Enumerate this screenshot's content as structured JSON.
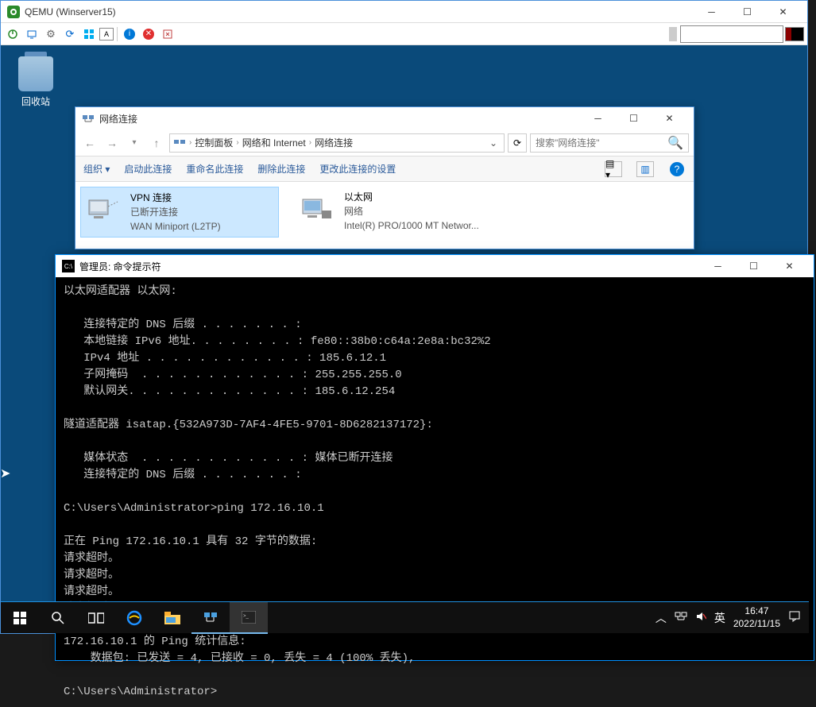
{
  "qemu": {
    "title": "QEMU (Winserver15)"
  },
  "desktop": {
    "recycle_bin": "回收站"
  },
  "explorer": {
    "title": "网络连接",
    "breadcrumb": [
      "控制面板",
      "网络和 Internet",
      "网络连接"
    ],
    "search_placeholder": "搜索\"网络连接\"",
    "cmdbar": {
      "organize": "组织 ▾",
      "start": "启动此连接",
      "rename": "重命名此连接",
      "delete": "删除此连接",
      "change": "更改此连接的设置"
    },
    "connections": [
      {
        "name": "VPN 连接",
        "status": "已断开连接",
        "device": "WAN Miniport (L2TP)",
        "selected": true
      },
      {
        "name": "以太网",
        "status": "网络",
        "device": "Intel(R) PRO/1000 MT Networ...",
        "selected": false
      }
    ]
  },
  "cmd": {
    "title": "管理员: 命令提示符",
    "output": "以太网适配器 以太网:\n\n   连接特定的 DNS 后缀 . . . . . . . :\n   本地链接 IPv6 地址. . . . . . . . : fe80::38b0:c64a:2e8a:bc32%2\n   IPv4 地址 . . . . . . . . . . . . : 185.6.12.1\n   子网掩码  . . . . . . . . . . . . : 255.255.255.0\n   默认网关. . . . . . . . . . . . . : 185.6.12.254\n\n隧道适配器 isatap.{532A973D-7AF4-4FE5-9701-8D6282137172}:\n\n   媒体状态  . . . . . . . . . . . . : 媒体已断开连接\n   连接特定的 DNS 后缀 . . . . . . . :\n\nC:\\Users\\Administrator>ping 172.16.10.1\n\n正在 Ping 172.16.10.1 具有 32 字节的数据:\n请求超时。\n请求超时。\n请求超时。\n请求超时。\n\n172.16.10.1 的 Ping 统计信息:\n    数据包: 已发送 = 4, 已接收 = 0, 丢失 = 4 (100% 丢失),\n\nC:\\Users\\Administrator>"
  },
  "taskbar": {
    "ime": "英",
    "time": "16:47",
    "date": "2022/11/15"
  }
}
